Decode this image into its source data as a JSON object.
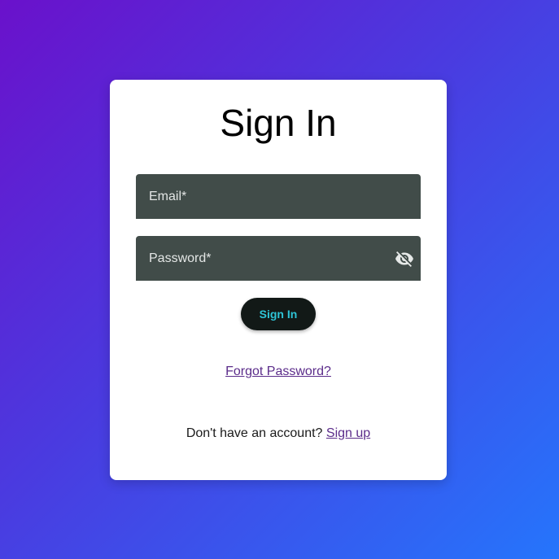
{
  "form": {
    "title": "Sign In",
    "email_placeholder": "Email*",
    "password_placeholder": "Password*",
    "password_visibility_icon": "eye-off-icon",
    "submit_label": "Sign In",
    "forgot_label": "Forgot Password?",
    "signup_prompt": "Don't have an account?",
    "signup_label": "Sign up"
  },
  "colors": {
    "background_start": "#6a11cb",
    "background_end": "#2575fc",
    "card": "#ffffff",
    "field_background": "#414c49",
    "button_background": "#121917",
    "button_text": "#2ec4d6",
    "link": "#5b2c8a"
  }
}
